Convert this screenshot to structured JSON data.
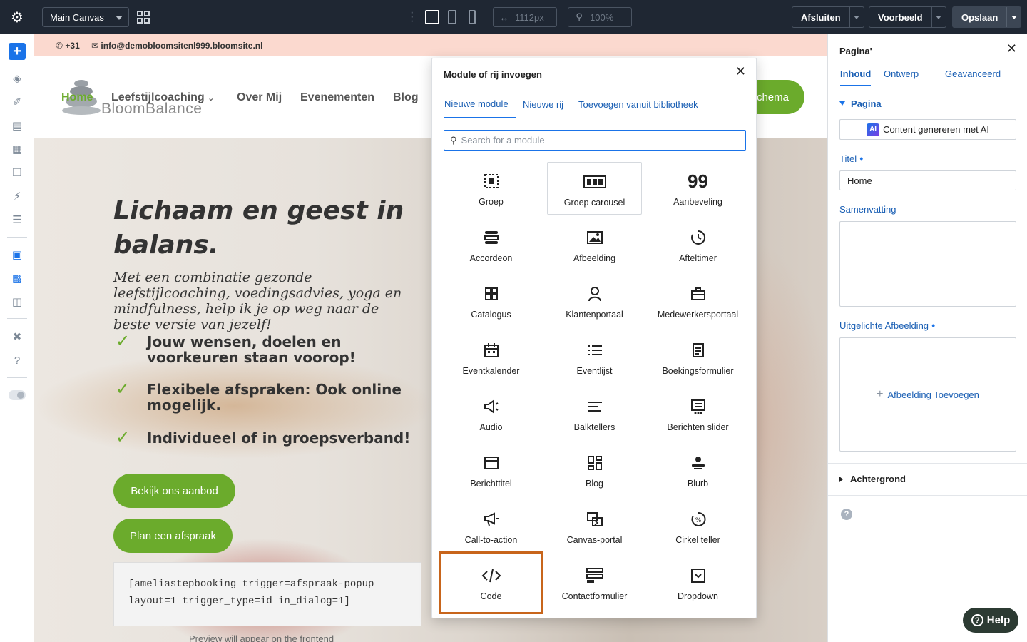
{
  "topbar": {
    "canvas_select": "Main Canvas",
    "width_value": "1112px",
    "zoom_value": "100%",
    "close_label": "Afsluiten",
    "preview_label": "Voorbeeld",
    "save_label": "Opslaan"
  },
  "site": {
    "phone": "+31",
    "email": "info@demobloomsitenl999.bloomsite.nl",
    "logo_text": "BloomBalance",
    "nav": [
      "Home",
      "Leefstijlcoaching",
      "Over Mij",
      "Evenementen",
      "Blog"
    ],
    "nav_cta": "chema",
    "hero_title": "Lichaam en geest in balans.",
    "hero_subtitle": "Met een combinatie gezonde leefstijlcoaching, voedingsadvies, yoga en mindfulness, help ik je op weg naar de beste versie van jezelf!",
    "bullets": [
      "Jouw wensen, doelen en voorkeuren staan voorop!",
      "Flexibele afspraken: Ook online mogelijk.",
      "Individueel of in groepsverband!"
    ],
    "btn_offer": "Bekijk ons aanbod",
    "btn_appointment": "Plan een afspraak",
    "shortcode": "[ameliastepbooking trigger=afspraak-popup layout=1 trigger_type=id in_dialog=1]",
    "preview_note": "Preview will appear on the frontend"
  },
  "modal": {
    "title": "Module of rij invoegen",
    "tabs": [
      "Nieuwe module",
      "Nieuwe rij",
      "Toevoegen vanuit bibliotheek"
    ],
    "search_placeholder": "Search for a module",
    "modules": [
      {
        "label": "Groep",
        "icon": "group-icon"
      },
      {
        "label": "Groep carousel",
        "icon": "group-carousel-icon"
      },
      {
        "label": "Aanbeveling",
        "icon": "quote-icon"
      },
      {
        "label": "Accordeon",
        "icon": "accordion-icon"
      },
      {
        "label": "Afbeelding",
        "icon": "image-icon"
      },
      {
        "label": "Afteltimer",
        "icon": "timer-icon"
      },
      {
        "label": "Catalogus",
        "icon": "catalog-icon"
      },
      {
        "label": "Klantenportaal",
        "icon": "user-icon"
      },
      {
        "label": "Medewerkersportaal",
        "icon": "briefcase-icon"
      },
      {
        "label": "Eventkalender",
        "icon": "calendar-icon"
      },
      {
        "label": "Eventlijst",
        "icon": "list-icon"
      },
      {
        "label": "Boekingsformulier",
        "icon": "form-icon"
      },
      {
        "label": "Audio",
        "icon": "audio-icon"
      },
      {
        "label": "Balktellers",
        "icon": "bars-icon"
      },
      {
        "label": "Berichten slider",
        "icon": "slider-icon"
      },
      {
        "label": "Berichttitel",
        "icon": "post-title-icon"
      },
      {
        "label": "Blog",
        "icon": "blog-icon"
      },
      {
        "label": "Blurb",
        "icon": "blurb-icon"
      },
      {
        "label": "Call-to-action",
        "icon": "megaphone-icon"
      },
      {
        "label": "Canvas-portal",
        "icon": "canvas-portal-icon"
      },
      {
        "label": "Cirkel teller",
        "icon": "circle-counter-icon"
      },
      {
        "label": "Code",
        "icon": "code-icon"
      },
      {
        "label": "Contactformulier",
        "icon": "contact-form-icon"
      },
      {
        "label": "Dropdown",
        "icon": "dropdown-icon"
      }
    ]
  },
  "panel": {
    "title": "Pagina'",
    "tabs": [
      "Inhoud",
      "Ontwerp",
      "Geavanceerd"
    ],
    "section": "Pagina",
    "ai_button": "Content genereren met AI",
    "ai_badge": "AI",
    "title_label": "Titel",
    "title_value": "Home",
    "summary_label": "Samenvatting",
    "featured_label": "Uitgelichte Afbeelding",
    "add_image": "Afbeelding Toevoegen",
    "background_label": "Achtergrond"
  },
  "help_label": "Help",
  "colors": {
    "accent": "#1a73e8",
    "topbar": "#1f2733",
    "brand_green": "#6bab2c",
    "selection": "#c8651b"
  }
}
